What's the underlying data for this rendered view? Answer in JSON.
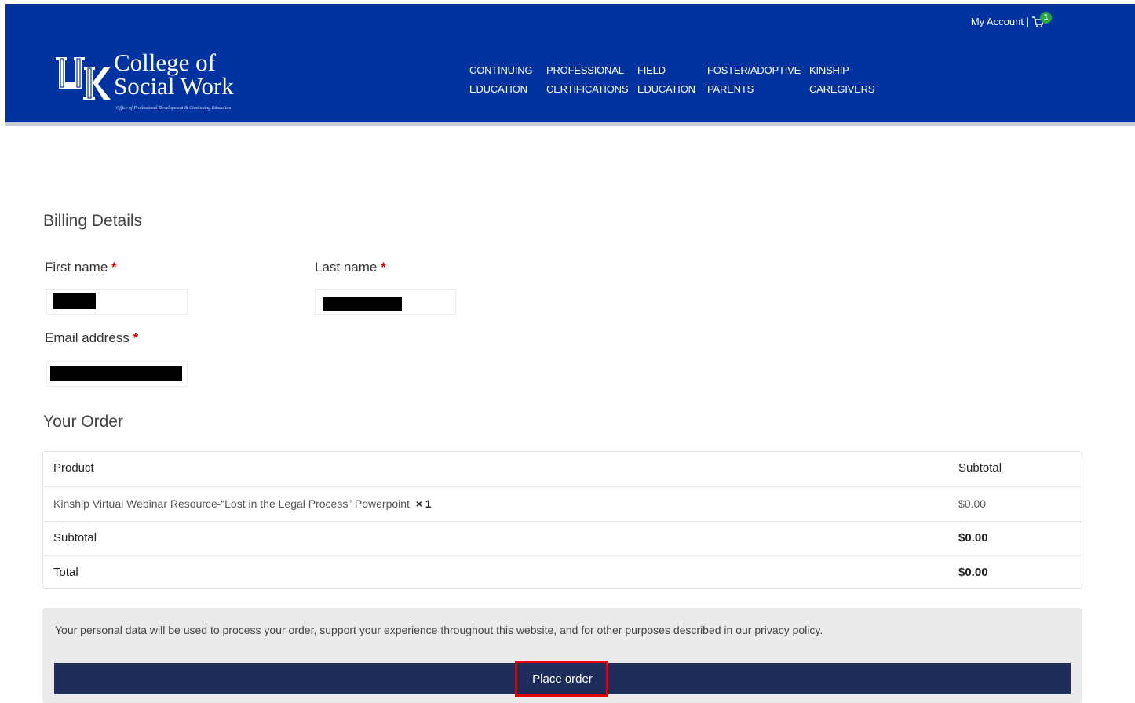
{
  "header": {
    "logo_line1": "College of",
    "logo_line2": "Social Work",
    "logo_tagline": "Office of Professional Development & Continuing Education",
    "account_label": "My Account |",
    "cart_count": "1",
    "nav": [
      {
        "line1": "CONTINUING",
        "line2": "EDUCATION"
      },
      {
        "line1": "PROFESSIONAL",
        "line2": "CERTIFICATIONS"
      },
      {
        "line1": "FIELD",
        "line2": "EDUCATION"
      },
      {
        "line1": "FOSTER/ADOPTIVE",
        "line2": "PARENTS"
      },
      {
        "line1": "KINSHIP",
        "line2": "CAREGIVERS"
      }
    ],
    "colors": {
      "brand": "#0033a0"
    }
  },
  "billing": {
    "title": "Billing Details",
    "first_name_label": "First name",
    "last_name_label": "Last name",
    "email_label": "Email address",
    "required_mark": "*"
  },
  "order": {
    "title": "Your Order",
    "columns": {
      "product": "Product",
      "subtotal": "Subtotal"
    },
    "item_name": "Kinship Virtual Webinar Resource-“Lost in the Legal Process” Powerpoint",
    "item_qty": "× 1",
    "item_subtotal": "$0.00",
    "subtotal_label": "Subtotal",
    "subtotal_value": "$0.00",
    "total_label": "Total",
    "total_value": "$0.00"
  },
  "payment": {
    "privacy_text": "Your personal data will be used to process your order, support your experience throughout this website, and for other purposes described in our privacy policy.",
    "place_order_label": "Place order",
    "button_color": "#1f2d5a"
  }
}
